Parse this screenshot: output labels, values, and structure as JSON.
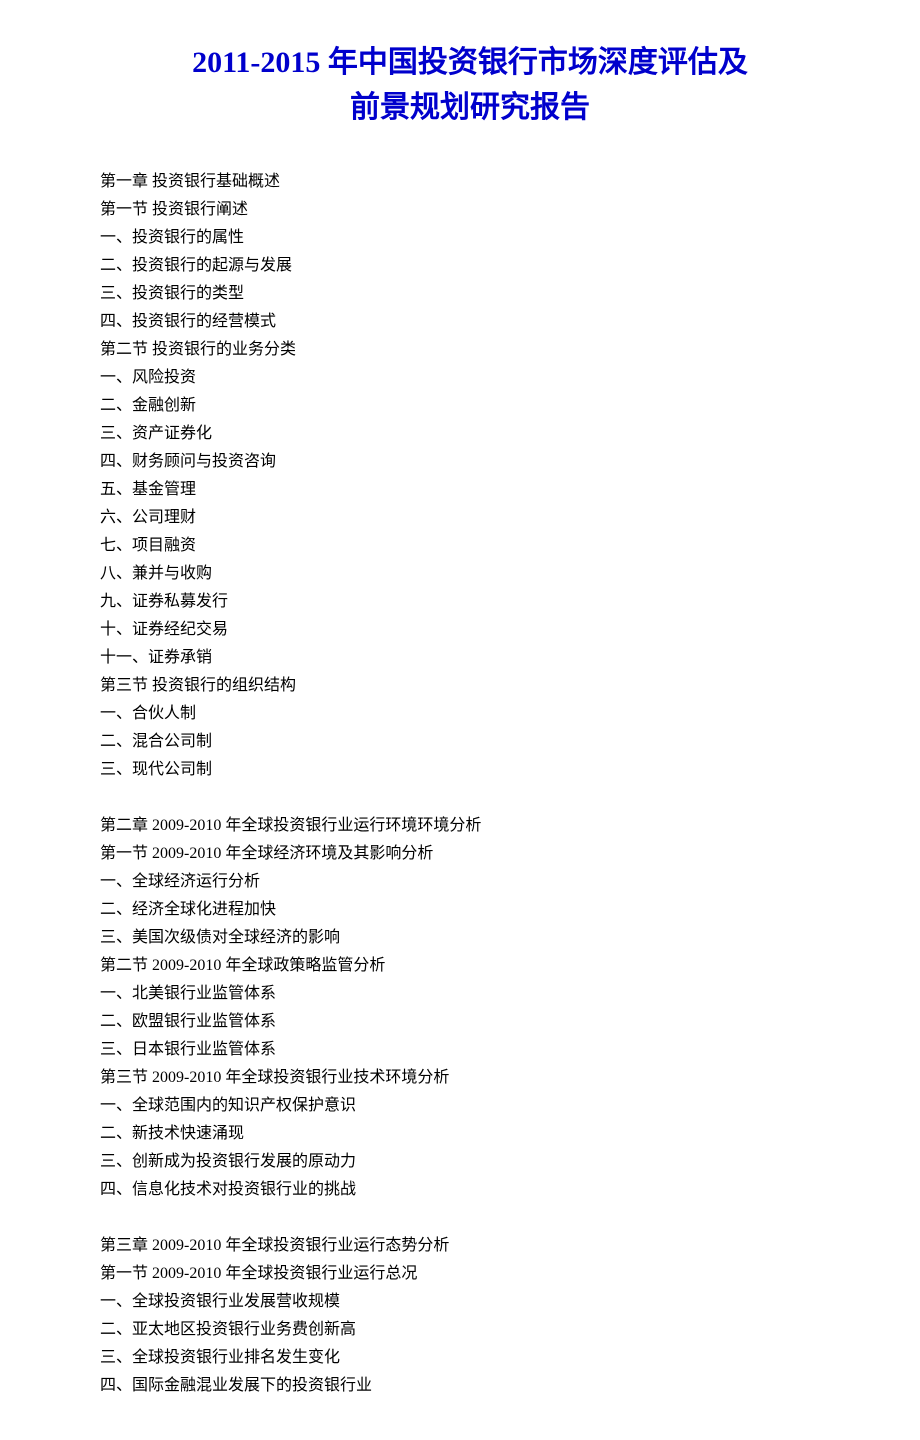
{
  "title_line1": "2011-2015 年中国投资银行市场深度评估及",
  "title_line2": "前景规划研究报告",
  "lines": [
    "第一章  投资银行基础概述",
    "第一节  投资银行阐述",
    "一、投资银行的属性",
    "二、投资银行的起源与发展",
    "三、投资银行的类型",
    "四、投资银行的经营模式",
    "第二节  投资银行的业务分类",
    "一、风险投资",
    "二、金融创新",
    "三、资产证券化",
    "四、财务顾问与投资咨询",
    "五、基金管理",
    "六、公司理财",
    "七、项目融资",
    "八、兼并与收购",
    "九、证券私募发行",
    "十、证券经纪交易",
    "十一、证券承销",
    "第三节  投资银行的组织结构",
    "一、合伙人制",
    "二、混合公司制",
    "三、现代公司制",
    "",
    "第二章    2009-2010 年全球投资银行业运行环境环境分析",
    "第一节  2009-2010 年全球经济环境及其影响分析",
    "一、全球经济运行分析",
    "二、经济全球化进程加快",
    "三、美国次级债对全球经济的影响",
    "第二节  2009-2010 年全球政策略监管分析",
    "一、北美银行业监管体系",
    "二、欧盟银行业监管体系",
    "三、日本银行业监管体系",
    "第三节    2009-2010 年全球投资银行业技术环境分析",
    "一、全球范围内的知识产权保护意识",
    "二、新技术快速涌现",
    "三、创新成为投资银行发展的原动力",
    "四、信息化技术对投资银行业的挑战",
    "",
    "第三章  2009-2010 年全球投资银行业运行态势分析",
    "第一节 2009-2010 年全球投资银行业运行总况",
    "一、全球投资银行业发展营收规模",
    "二、亚太地区投资银行业务费创新高",
    "三、全球投资银行业排名发生变化",
    "四、国际金融混业发展下的投资银行业"
  ]
}
